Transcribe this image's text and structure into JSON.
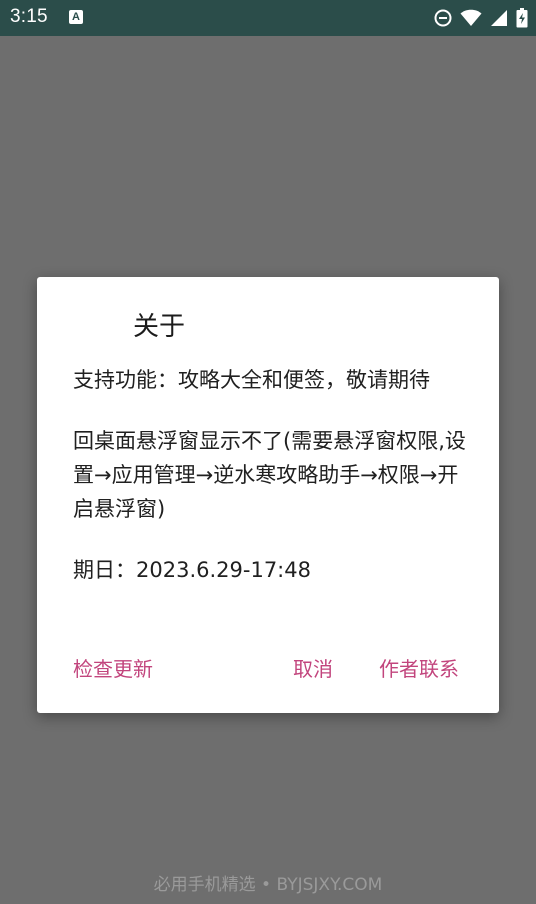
{
  "status_bar": {
    "time": "3:15",
    "notification_icon": "A"
  },
  "dialog": {
    "title": "关于",
    "paragraphs": [
      "支持功能：攻略大全和便签，敬请期待",
      "回桌面悬浮窗显示不了(需要悬浮窗权限,设置→应用管理→逆水寒攻略助手→权限→开启悬浮窗)",
      "期日：2023.6.29-17:48"
    ],
    "buttons": {
      "check_update": "检查更新",
      "cancel": "取消",
      "contact_author": "作者联系"
    },
    "accent_color": "#c2457d"
  },
  "watermark": "必用手机精选 • BYJSJXY.COM"
}
